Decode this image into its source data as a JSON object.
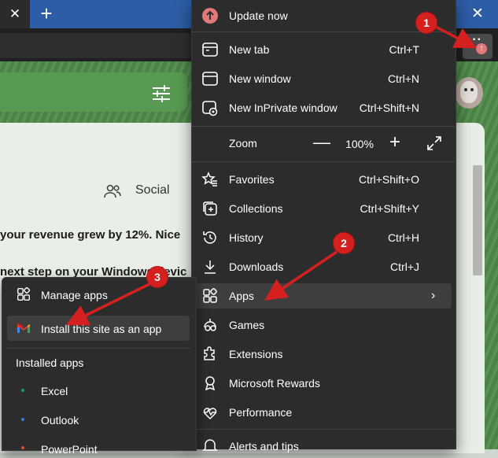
{
  "tab_bar": {
    "close_glyph": "✕",
    "new_tab_glyph": "+",
    "window_close_glyph": "✕"
  },
  "toolbar": {
    "menu_glyph": "···",
    "update_badge_glyph": "↑"
  },
  "page": {
    "social_label": "Social",
    "line1": "your revenue grew by 12%. Nice",
    "line2": "next step on your Windows devic"
  },
  "menu": {
    "update": {
      "label": "Update now",
      "icon": "update-icon"
    },
    "items": [
      {
        "label": "New tab",
        "shortcut": "Ctrl+T",
        "icon": "new-tab-icon"
      },
      {
        "label": "New window",
        "shortcut": "Ctrl+N",
        "icon": "new-window-icon"
      },
      {
        "label": "New InPrivate window",
        "shortcut": "Ctrl+Shift+N",
        "icon": "inprivate-icon"
      }
    ],
    "zoom": {
      "label": "Zoom",
      "minus": "—",
      "value": "100%",
      "plus": "+"
    },
    "items2": [
      {
        "label": "Favorites",
        "shortcut": "Ctrl+Shift+O",
        "icon": "favorites-icon"
      },
      {
        "label": "Collections",
        "shortcut": "Ctrl+Shift+Y",
        "icon": "collections-icon"
      },
      {
        "label": "History",
        "shortcut": "Ctrl+H",
        "icon": "history-icon"
      },
      {
        "label": "Downloads",
        "shortcut": "Ctrl+J",
        "icon": "downloads-icon"
      },
      {
        "label": "Apps",
        "shortcut": "",
        "icon": "apps-icon"
      },
      {
        "label": "Games",
        "shortcut": "",
        "icon": "games-icon"
      },
      {
        "label": "Extensions",
        "shortcut": "",
        "icon": "extensions-icon"
      },
      {
        "label": "Microsoft Rewards",
        "shortcut": "",
        "icon": "rewards-icon"
      },
      {
        "label": "Performance",
        "shortcut": "",
        "icon": "performance-icon"
      },
      {
        "label": "Alerts and tips",
        "shortcut": "",
        "icon": "alerts-icon"
      }
    ],
    "chevron": "›"
  },
  "submenu": {
    "manage_apps": "Manage apps",
    "install_site": "Install this site as an app",
    "installed_heading": "Installed apps",
    "apps": [
      {
        "label": "Excel",
        "color": "#1f9d55"
      },
      {
        "label": "Outlook",
        "color": "#2b7cd3"
      },
      {
        "label": "PowerPoint",
        "color": "#d35230"
      }
    ]
  },
  "annotations": {
    "badges": [
      "1",
      "2",
      "3"
    ],
    "color": "#d62020"
  }
}
